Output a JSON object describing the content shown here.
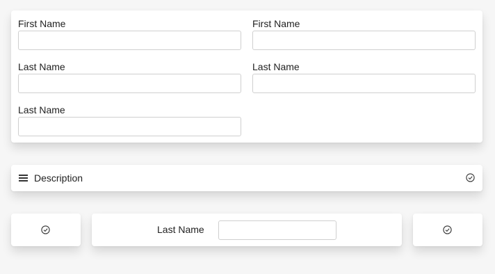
{
  "form": {
    "fields": [
      {
        "label": "First Name",
        "value": "",
        "placeholder": ""
      },
      {
        "label": "First Name",
        "value": "",
        "placeholder": ""
      },
      {
        "label": "Last Name",
        "value": "",
        "placeholder": ""
      },
      {
        "label": "Last Name",
        "value": "",
        "placeholder": ""
      },
      {
        "label": "Last Name",
        "value": "",
        "placeholder": ""
      }
    ]
  },
  "description_bar": {
    "label": "Description",
    "left_icon": "menu-icon",
    "right_icon": "check-circle-icon"
  },
  "bottom_row": {
    "left_icon": "check-circle-icon",
    "middle": {
      "label": "Last Name",
      "value": "",
      "placeholder": ""
    },
    "right_icon": "check-circle-icon"
  },
  "colors": {
    "background": "#f6f6f6",
    "card": "#ffffff",
    "input_border": "#cfcfcf",
    "text": "#222222"
  }
}
